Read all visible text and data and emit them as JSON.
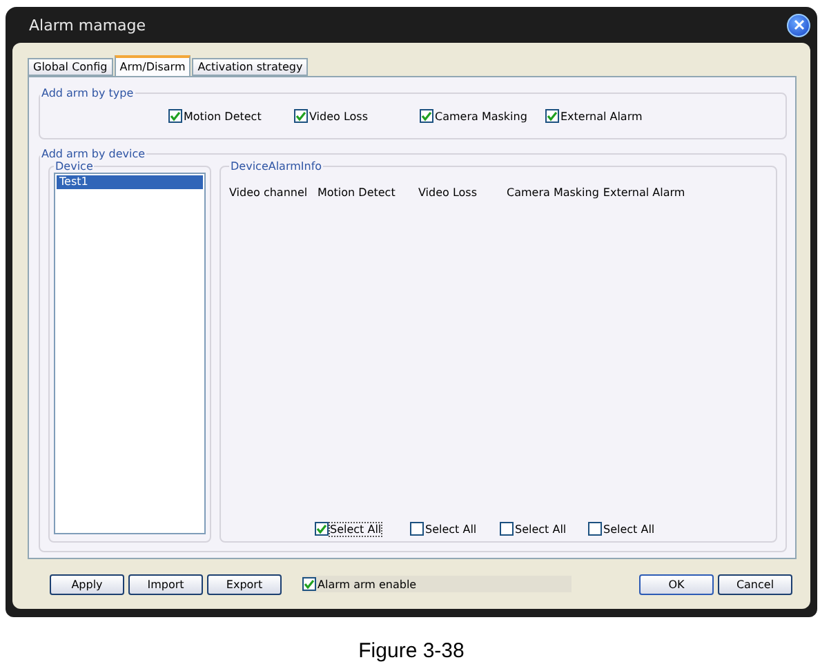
{
  "window": {
    "title": "Alarm mamage"
  },
  "tabs": [
    {
      "label": "Global Config",
      "selected": false
    },
    {
      "label": "Arm/Disarm",
      "selected": true
    },
    {
      "label": "Activation strategy",
      "selected": false
    }
  ],
  "arm_by_type": {
    "title": "Add arm by type",
    "options": [
      {
        "label": "Motion Detect",
        "checked": true
      },
      {
        "label": "Video Loss",
        "checked": true
      },
      {
        "label": "Camera Masking",
        "checked": true
      },
      {
        "label": "External Alarm",
        "checked": true
      }
    ]
  },
  "arm_by_device": {
    "title": "Add arm by device",
    "device_list": {
      "title": "Device",
      "items": [
        {
          "label": "Test1",
          "selected": true
        }
      ]
    },
    "alarm_info": {
      "title": "DeviceAlarmInfo",
      "columns": [
        "Video channel",
        "Motion Detect",
        "Video Loss",
        "Camera Masking",
        "External Alarm"
      ],
      "select_all": [
        {
          "label": "Select All",
          "checked": true
        },
        {
          "label": "Select All",
          "checked": false
        },
        {
          "label": "Select All",
          "checked": false
        },
        {
          "label": "Select All",
          "checked": false
        }
      ]
    }
  },
  "footer": {
    "buttons": [
      "Apply",
      "Import",
      "Export"
    ],
    "alarm_enable": {
      "label": "Alarm arm enable",
      "checked": true
    },
    "dialog_buttons": [
      "OK",
      "Cancel"
    ]
  },
  "caption": "Figure 3-38"
}
